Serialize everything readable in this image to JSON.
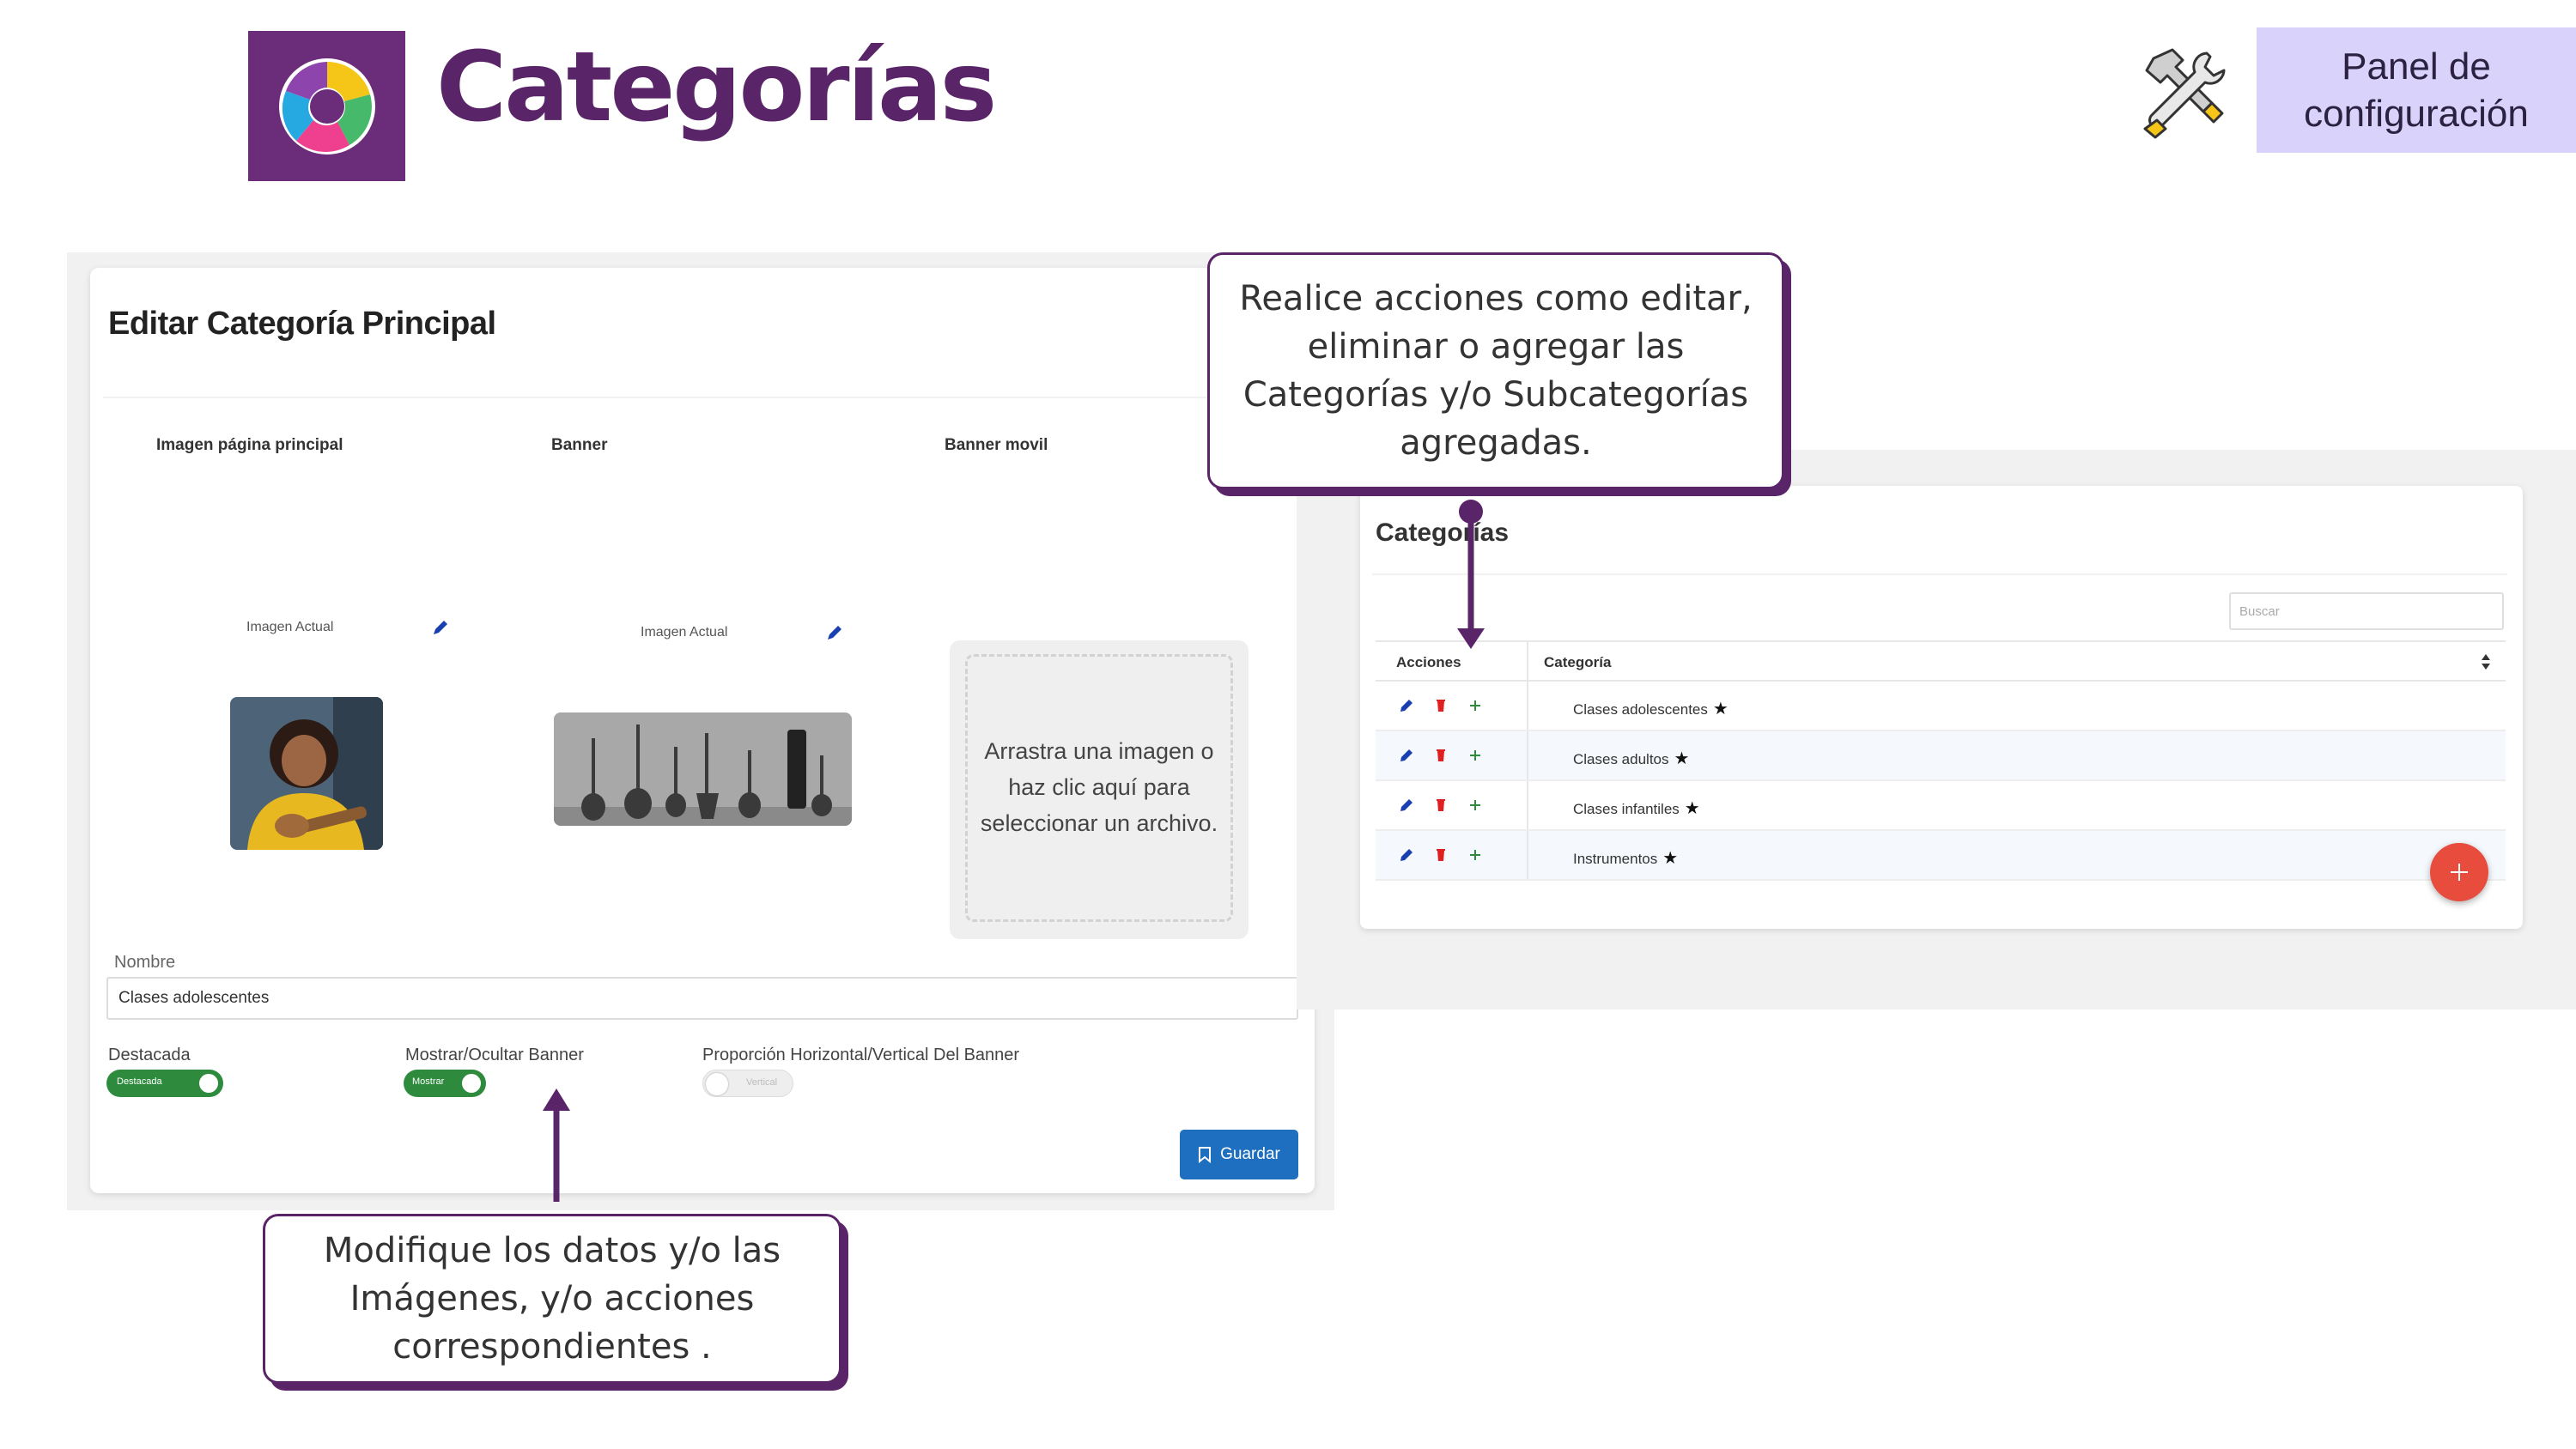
{
  "header": {
    "title": "Categorías",
    "panel_badge": "Panel de configuración",
    "logo_icon": "color-wheel-icon",
    "tools_icon": "hammer-wrench-icon"
  },
  "editor": {
    "title": "Editar Categoría Principal",
    "columns": [
      "Imagen página principal",
      "Banner",
      "Banner movil"
    ],
    "image_current_label": "Imagen Actual",
    "banner_current_label": "Imagen Actual",
    "dropzone_text": "Arrastra una imagen o haz clic aquí para seleccionar un archivo.",
    "name_label": "Nombre",
    "name_value": "Clases adolescentes",
    "toggles": [
      {
        "label": "Destacada",
        "state_text": "Destacada",
        "on": true
      },
      {
        "label": "Mostrar/Ocultar Banner",
        "state_text": "Mostrar",
        "on": true
      },
      {
        "label": "Proporción Horizontal/Vertical Del Banner",
        "state_text": "Vertical",
        "on": false
      }
    ],
    "save_label": "Guardar"
  },
  "categories": {
    "title": "Categorías",
    "search_placeholder": "Buscar",
    "headers": {
      "actions": "Acciones",
      "category": "Categoría"
    },
    "rows": [
      {
        "name": "Clases adolescentes"
      },
      {
        "name": "Clases adultos"
      },
      {
        "name": "Clases infantiles"
      },
      {
        "name": "Instrumentos"
      }
    ],
    "star": "★"
  },
  "callouts": {
    "top": "Realice acciones como editar, eliminar o agregar las Categorías y/o Subcategorías agregadas.",
    "bottom": "Modifique los datos y/o las Imágenes, y/o acciones correspondientes ."
  },
  "colors": {
    "brand_purple": "#5a2468",
    "badge_lavender": "#d9d3fb",
    "toggle_green": "#2e8b3e",
    "save_blue": "#1e6fbf",
    "fab_red": "#e74c3c"
  }
}
